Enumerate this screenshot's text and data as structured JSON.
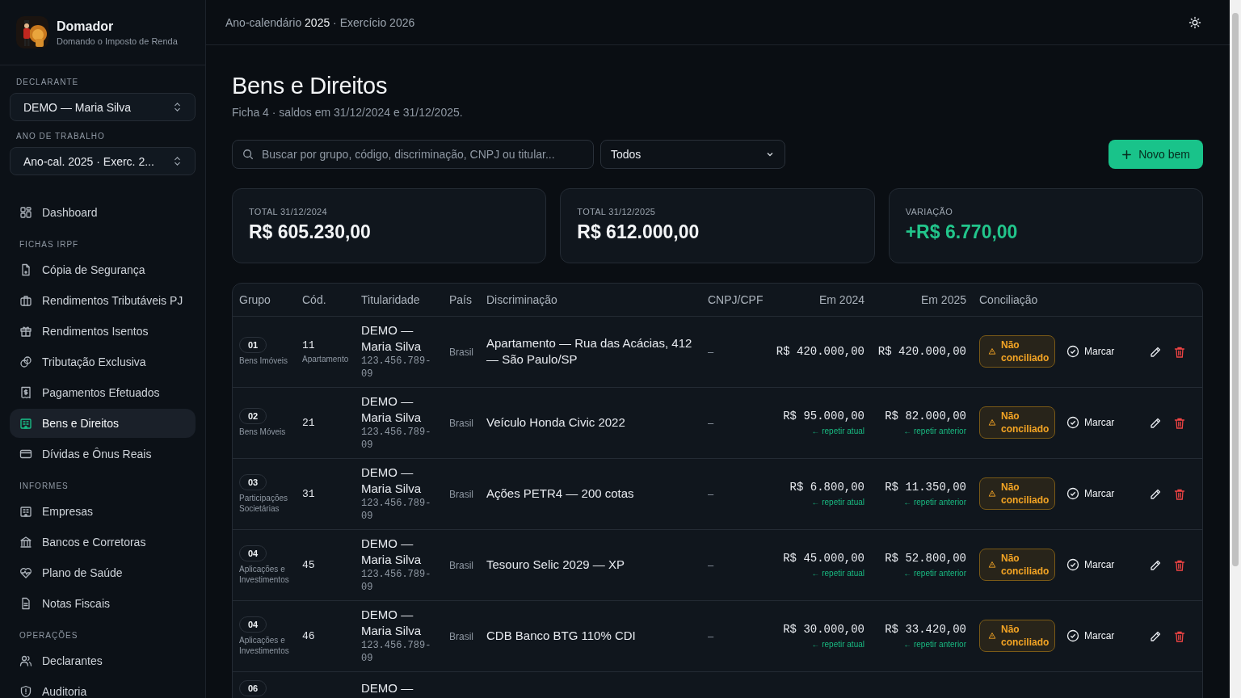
{
  "app": {
    "name": "Domador",
    "tagline": "Domando o Imposto de Renda"
  },
  "sidebar": {
    "selectors": [
      {
        "label": "DECLARANTE",
        "value": "DEMO — Maria Silva"
      },
      {
        "label": "ANO DE TRABALHO",
        "value": "Ano-cal. 2025 · Exerc. 2..."
      }
    ],
    "sections": [
      {
        "items": [
          {
            "label": "Dashboard",
            "selected": false
          }
        ]
      },
      {
        "title": "FICHAS IRPF",
        "items": [
          {
            "label": "Cópia de Segurança",
            "selected": false
          },
          {
            "label": "Rendimentos Tributáveis PJ",
            "selected": false
          },
          {
            "label": "Rendimentos Isentos",
            "selected": false
          },
          {
            "label": "Tributação Exclusiva",
            "selected": false
          },
          {
            "label": "Pagamentos Efetuados",
            "selected": false
          },
          {
            "label": "Bens e Direitos",
            "selected": true
          },
          {
            "label": "Dívidas e Ônus Reais",
            "selected": false
          }
        ]
      },
      {
        "title": "INFORMES",
        "items": [
          {
            "label": "Empresas",
            "selected": false
          },
          {
            "label": "Bancos e Corretoras",
            "selected": false
          },
          {
            "label": "Plano de Saúde",
            "selected": false
          },
          {
            "label": "Notas Fiscais",
            "selected": false
          }
        ]
      },
      {
        "title": "OPERAÇÕES",
        "items": [
          {
            "label": "Declarantes",
            "selected": false
          },
          {
            "label": "Auditoria",
            "selected": false
          }
        ]
      }
    ]
  },
  "topbar": {
    "context": "Ano-calendário **2025** · Exercício 2026"
  },
  "page": {
    "title": "Bens e Direitos",
    "subtitle": "Ficha 4 · saldos em 31/12/2024 e 31/12/2025."
  },
  "toolbar": {
    "search_placeholder": "Buscar por grupo, código, discriminação, CNPJ ou titular...",
    "filter": "Todos",
    "add_button": "Novo bem"
  },
  "summary": [
    {
      "label": "TOTAL 31/12/2024",
      "value": "R$ 605.230,00",
      "kind": "neutral"
    },
    {
      "label": "TOTAL 31/12/2025",
      "value": "R$ 612.000,00",
      "kind": "neutral"
    },
    {
      "label": "VARIAÇÃO",
      "value": "+R$ 6.770,00",
      "kind": "positive"
    }
  ],
  "table": {
    "columns": [
      "Grupo",
      "Cód.",
      "Titularidade",
      "País",
      "Discriminação",
      "CNPJ/CPF",
      "Em 2024",
      "Em 2025",
      "Conciliação"
    ],
    "rows": [
      {
        "grupo": "01",
        "grupo_nome": "Bens Imóveis",
        "codigo": "11",
        "codigo_nome": "Apartamento",
        "titular": "DEMO — Maria Silva",
        "cpf": "123.456.789-09",
        "pais": "Brasil",
        "discriminacao": "Apartamento — Rua das Acácias, 412 — São Paulo/SP",
        "cnpj": "–",
        "em_2024": "R$ 420.000,00",
        "em_2025": "R$ 420.000,00",
        "conciliado": false,
        "status": "Não conciliado",
        "action": "Marcar"
      },
      {
        "grupo": "02",
        "grupo_nome": "Bens Móveis",
        "codigo": "21",
        "titular": "DEMO — Maria Silva",
        "cpf": "123.456.789-09",
        "pais": "Brasil",
        "discriminacao": "Veículo Honda Civic 2022",
        "cnpj": "–",
        "em_2024": "R$ 95.000,00",
        "hint_2024": "← repetir atual",
        "em_2025": "R$ 82.000,00",
        "hint_2025": "← repetir anterior",
        "conciliado": false,
        "status": "Não conciliado",
        "action": "Marcar"
      },
      {
        "grupo": "03",
        "grupo_nome": "Participações Societárias",
        "codigo": "31",
        "titular": "DEMO — Maria Silva",
        "cpf": "123.456.789-09",
        "pais": "Brasil",
        "discriminacao": "Ações PETR4 — 200 cotas",
        "cnpj": "–",
        "em_2024": "R$ 6.800,00",
        "hint_2024": "← repetir atual",
        "em_2025": "R$ 11.350,00",
        "hint_2025": "← repetir anterior",
        "conciliado": false,
        "status": "Não conciliado",
        "action": "Marcar"
      },
      {
        "grupo": "04",
        "grupo_nome": "Aplicações e Investimentos",
        "codigo": "45",
        "titular": "DEMO — Maria Silva",
        "cpf": "123.456.789-09",
        "pais": "Brasil",
        "discriminacao": "Tesouro Selic 2029 — XP",
        "cnpj": "–",
        "em_2024": "R$ 45.000,00",
        "hint_2024": "← repetir atual",
        "em_2025": "R$ 52.800,00",
        "hint_2025": "← repetir anterior",
        "conciliado": false,
        "status": "Não conciliado",
        "action": "Marcar"
      },
      {
        "grupo": "04",
        "grupo_nome": "Aplicações e Investimentos",
        "codigo": "46",
        "titular": "DEMO — Maria Silva",
        "cpf": "123.456.789-09",
        "pais": "Brasil",
        "discriminacao": "CDB Banco BTG 110% CDI",
        "cnpj": "–",
        "em_2024": "R$ 30.000,00",
        "hint_2024": "← repetir atual",
        "em_2025": "R$ 33.420,00",
        "hint_2025": "← repetir anterior",
        "conciliado": false,
        "status": "Não conciliado",
        "action": "Marcar"
      },
      {
        "grupo": "06",
        "titular": "DEMO —"
      }
    ]
  }
}
